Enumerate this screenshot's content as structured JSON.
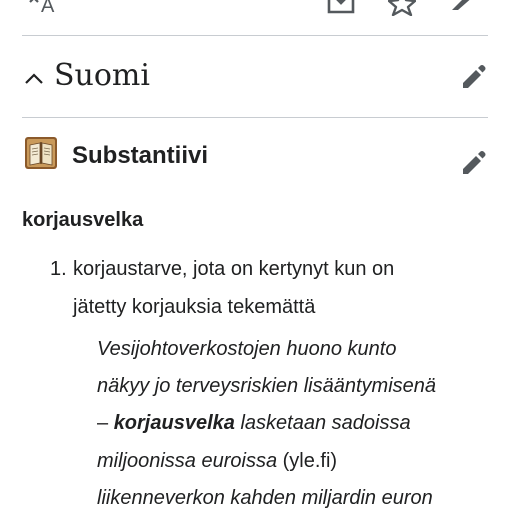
{
  "toolbar": {
    "icons": [
      "translate-icon",
      "download-icon",
      "star-icon",
      "edit-icon"
    ],
    "translate_glyph": "A"
  },
  "section": {
    "language": "Suomi"
  },
  "part_of_speech": {
    "label": "Substantiivi"
  },
  "entry": {
    "headword": "korjausvelka",
    "definition": {
      "number": "1.",
      "line1": "korjaustarve, jota on kertynyt kun on",
      "line2": "jätetty korjauksia tekemättä"
    },
    "example": {
      "line1": "Vesijohtoverkostojen huono kunto",
      "line2": "näkyy jo terveysriskien lisääntymisenä",
      "line3_dash": "–",
      "line3_bold": "korjausvelka",
      "line3_rest": "lasketaan sadoissa",
      "line4_italic": "miljoonissa euroissa",
      "line4_source": "(yle.fi)",
      "line5": "liikenneverkon kahden miljardin euron"
    }
  },
  "colors": {
    "text": "#202122",
    "icon": "#54595d",
    "divider": "#c8ccd1"
  }
}
